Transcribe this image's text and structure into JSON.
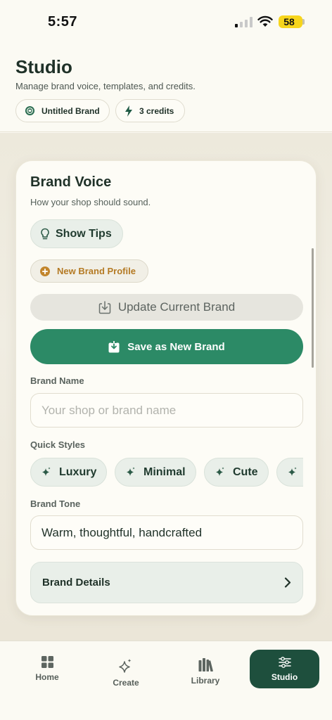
{
  "status_bar": {
    "time": "5:57",
    "battery": "58"
  },
  "header": {
    "title": "Studio",
    "subtitle": "Manage brand voice, templates, and credits.",
    "brand_chip": "Untitled Brand",
    "credits_chip": "3 credits"
  },
  "brand_voice": {
    "title": "Brand Voice",
    "subtitle": "How your shop should sound.",
    "show_tips": "Show Tips",
    "new_profile": "New Brand Profile",
    "update_brand": "Update Current Brand",
    "save_new": "Save as New Brand",
    "brand_name_label": "Brand Name",
    "brand_name_placeholder": "Your shop or brand name",
    "brand_name_value": "",
    "quick_styles_label": "Quick Styles",
    "quick_styles": [
      "Luxury",
      "Minimal",
      "Cute"
    ],
    "brand_tone_label": "Brand Tone",
    "brand_tone_value": "Warm, thoughtful, handcrafted",
    "brand_details": "Brand Details"
  },
  "tabs": [
    {
      "label": "Home",
      "icon": "grid-icon"
    },
    {
      "label": "Create",
      "icon": "sparkle-icon"
    },
    {
      "label": "Library",
      "icon": "books-icon"
    },
    {
      "label": "Studio",
      "icon": "sliders-icon",
      "active": true
    }
  ],
  "colors": {
    "accent": "#2c8a66",
    "active_tab": "#1e4f3d",
    "warning_text": "#b47a24",
    "battery": "#f7d51c"
  }
}
